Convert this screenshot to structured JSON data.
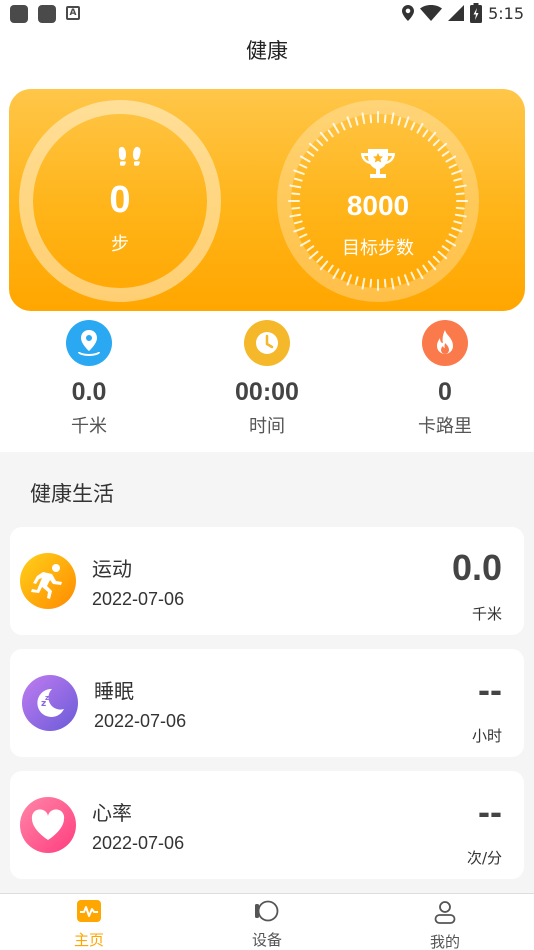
{
  "status_bar": {
    "time": "5:15",
    "badge": "A"
  },
  "header": {
    "title": "健康"
  },
  "summary": {
    "steps": "0",
    "steps_label": "步",
    "goal": "8000",
    "goal_label": "目标步数"
  },
  "stats": [
    {
      "value": "0.0",
      "label": "千米",
      "icon": "location-pin-icon",
      "color": "#2aa8f2"
    },
    {
      "value": "00:00",
      "label": "时间",
      "icon": "clock-icon",
      "color": "#f5b82a"
    },
    {
      "value": "0",
      "label": "卡路里",
      "icon": "flame-icon",
      "color": "#fb7a4b"
    }
  ],
  "section": {
    "title": "健康生活"
  },
  "items": [
    {
      "title": "运动",
      "date": "2022-07-06",
      "value": "0.0",
      "unit": "千米",
      "icon": "running-icon"
    },
    {
      "title": "睡眠",
      "date": "2022-07-06",
      "value": "--",
      "unit": "小时",
      "icon": "moon-icon"
    },
    {
      "title": "心率",
      "date": "2022-07-06",
      "value": "--",
      "unit": "次/分",
      "icon": "heart-icon"
    }
  ],
  "tabs": [
    {
      "label": "主页",
      "active": true,
      "icon": "pulse-icon"
    },
    {
      "label": "设备",
      "active": false,
      "icon": "watch-icon"
    },
    {
      "label": "我的",
      "active": false,
      "icon": "user-icon"
    }
  ],
  "colors": {
    "accent": "#ffb418",
    "tab_active": "#ffa600",
    "tab_inactive": "#555555"
  }
}
